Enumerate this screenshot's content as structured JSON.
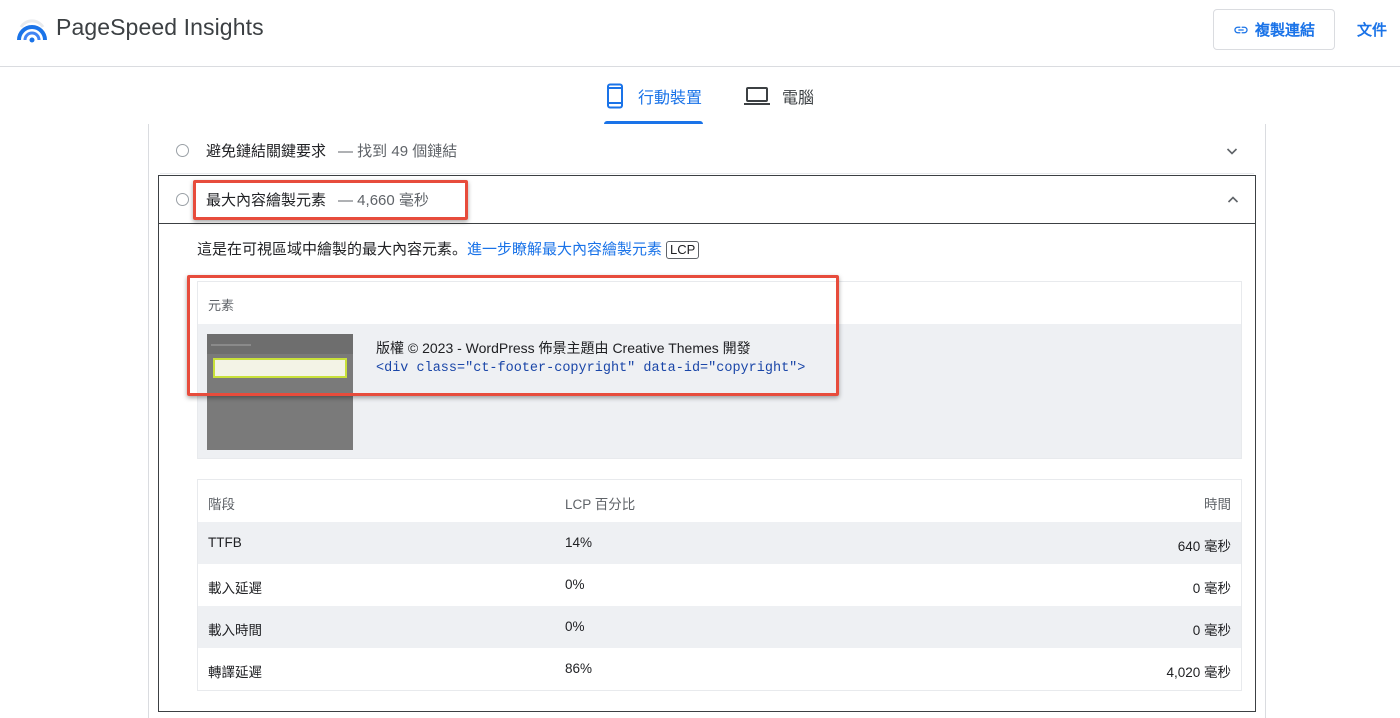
{
  "header": {
    "app_title": "PageSpeed Insights",
    "copy_link_label": "複製連結",
    "docs_label": "文件"
  },
  "tabs": [
    {
      "label": "行動裝置",
      "icon": "smartphone-icon",
      "active": true
    },
    {
      "label": "電腦",
      "icon": "laptop-icon",
      "active": false
    }
  ],
  "audits": [
    {
      "title": "避免鏈結關鍵要求",
      "summary": "— 找到 49 個鏈結",
      "expanded": false
    },
    {
      "title": "最大內容繪製元素",
      "summary": "— 4,660 毫秒",
      "expanded": true
    }
  ],
  "lcp_detail": {
    "description": "這是在可視區域中繪製的最大內容元素。",
    "learn_more_link": "進一步瞭解最大內容繪製元素",
    "tag": "LCP",
    "element_header": "元素",
    "element_text": "版權 © 2023 - WordPress 佈景主題由 Creative Themes 開發",
    "element_code": "<div class=\"ct-footer-copyright\" data-id=\"copyright\">"
  },
  "phases": {
    "columns": [
      "階段",
      "LCP 百分比",
      "時間"
    ],
    "rows": [
      {
        "phase": "TTFB",
        "percent": "14%",
        "time": "640 毫秒"
      },
      {
        "phase": "載入延遲",
        "percent": "0%",
        "time": "0 毫秒"
      },
      {
        "phase": "載入時間",
        "percent": "0%",
        "time": "0 毫秒"
      },
      {
        "phase": "轉譯延遲",
        "percent": "86%",
        "time": "4,020 毫秒"
      }
    ]
  },
  "colors": {
    "accent": "#1a73e8",
    "highlight": "#e74c3c",
    "row_alt": "#eef0f3"
  }
}
